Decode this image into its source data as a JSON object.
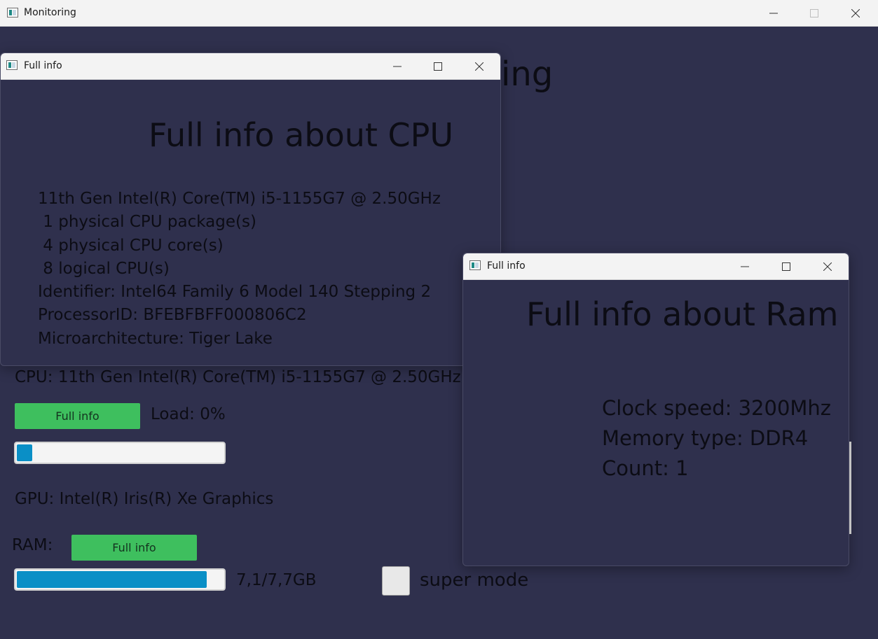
{
  "main_window": {
    "title": "Monitoring",
    "heading_visible_part": "ing",
    "cpu_label": "CPU: 11th Gen Intel(R) Core(TM) i5-1155G7 @ 2.50GHz",
    "cpu_full_info_button": "Full info",
    "cpu_load_label": "Load: 0%",
    "cpu_load_percent": 0,
    "gpu_label": "GPU: Intel(R) Iris(R) Xe Graphics",
    "ram_label": "RAM:",
    "ram_full_info_button": "Full info",
    "ram_usage_text": "7,1/7,7GB",
    "ram_usage_fraction": 0.922,
    "super_mode_label": "super mode",
    "super_mode_checked": false
  },
  "cpu_window": {
    "title": "Full info",
    "heading": "Full info about CPU",
    "lines": [
      "11th Gen Intel(R) Core(TM) i5-1155G7 @ 2.50GHz",
      " 1 physical CPU package(s)",
      " 4 physical CPU core(s)",
      " 8 logical CPU(s)",
      "Identifier: Intel64 Family 6 Model 140 Stepping 2",
      "ProcessorID: BFEBFBFF000806C2",
      "Microarchitecture: Tiger Lake"
    ]
  },
  "ram_window": {
    "title": "Full info",
    "heading": "Full info about Ram",
    "lines": [
      "Clock speed: 3200Mhz",
      "Memory type: DDR4",
      "Count: 1"
    ]
  },
  "colors": {
    "background": "#2f304d",
    "button_green": "#3ebf5e",
    "progress_blue": "#0a8fc6"
  }
}
